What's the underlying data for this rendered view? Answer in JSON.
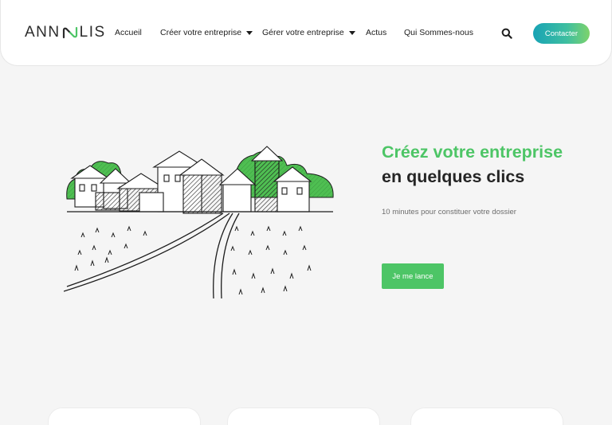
{
  "header": {
    "logo_text_left": "ANN",
    "logo_text_right": "LIS",
    "nav": [
      {
        "label": "Accueil",
        "has_dropdown": false
      },
      {
        "label": "Créer votre entreprise",
        "has_dropdown": true
      },
      {
        "label": "Gérer votre entreprise",
        "has_dropdown": true
      },
      {
        "label": "Actus",
        "has_dropdown": false
      },
      {
        "label": "Qui Sommes-nous",
        "has_dropdown": false
      }
    ],
    "contact_label": "Contacter"
  },
  "hero": {
    "title_line1": "Créez votre entreprise",
    "title_line2": "en quelques clics",
    "subtitle": "10 minutes pour constituer votre dossier",
    "cta_label": "Je me lance"
  },
  "colors": {
    "accent": "#4dc566",
    "contact_gradient_start": "#18a3b5",
    "contact_gradient_end": "#7ed36b",
    "background": "#f5f5f5"
  },
  "icons": {
    "search": "search-icon",
    "dropdown": "chevron-down-icon"
  }
}
